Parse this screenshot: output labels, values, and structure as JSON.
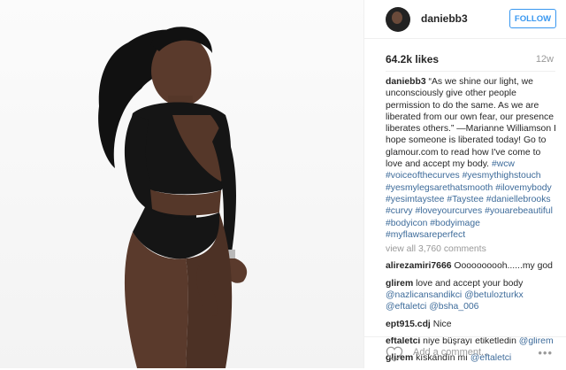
{
  "post": {
    "username": "daniebb3",
    "follow_label": "FOLLOW",
    "likes": "64.2k likes",
    "age": "12w",
    "caption": [
      {
        "t": "text",
        "v": "“As we shine our light, we unconsciously give other people permission to do the same. As we are liberated from our own fear, our presence liberates others.” —Marianne Williamson I hope someone is liberated today! Go to glamour.com to read how I've come to love and accept my body. "
      },
      {
        "t": "tag",
        "v": "#wcw"
      },
      {
        "t": "text",
        "v": " "
      },
      {
        "t": "tag",
        "v": "#voiceofthecurves"
      },
      {
        "t": "text",
        "v": " "
      },
      {
        "t": "tag",
        "v": "#yesmythighstouch"
      },
      {
        "t": "text",
        "v": " "
      },
      {
        "t": "tag",
        "v": "#yesmylegsarethatsmooth"
      },
      {
        "t": "text",
        "v": " "
      },
      {
        "t": "tag",
        "v": "#ilovemybody"
      },
      {
        "t": "text",
        "v": " "
      },
      {
        "t": "tag",
        "v": "#yesimtaystee"
      },
      {
        "t": "text",
        "v": " "
      },
      {
        "t": "tag",
        "v": "#Taystee"
      },
      {
        "t": "text",
        "v": " "
      },
      {
        "t": "tag",
        "v": "#daniellebrooks"
      },
      {
        "t": "text",
        "v": " "
      },
      {
        "t": "tag",
        "v": "#curvy"
      },
      {
        "t": "text",
        "v": " "
      },
      {
        "t": "tag",
        "v": "#loveyourcurves"
      },
      {
        "t": "text",
        "v": " "
      },
      {
        "t": "tag",
        "v": "#youarebeautiful"
      },
      {
        "t": "text",
        "v": " "
      },
      {
        "t": "tag",
        "v": "#bodyicon"
      },
      {
        "t": "text",
        "v": " "
      },
      {
        "t": "tag",
        "v": "#bodyimage"
      },
      {
        "t": "text",
        "v": " "
      },
      {
        "t": "tag",
        "v": "#myflawsareperfect"
      }
    ],
    "view_all": "view all 3,760 comments",
    "comments": [
      {
        "user": "alirezamiri7666",
        "parts": [
          {
            "t": "text",
            "v": "Oooooooooh......my god"
          }
        ]
      },
      {
        "user": "glirem",
        "parts": [
          {
            "t": "text",
            "v": "love and accept your body "
          },
          {
            "t": "tag",
            "v": "@nazlicansandikci"
          },
          {
            "t": "text",
            "v": " "
          },
          {
            "t": "tag",
            "v": "@betulozturkx"
          },
          {
            "t": "text",
            "v": " "
          },
          {
            "t": "tag",
            "v": "@eftaletci"
          },
          {
            "t": "text",
            "v": " "
          },
          {
            "t": "tag",
            "v": "@bsha_006"
          }
        ]
      },
      {
        "user": "ept915.cdj",
        "parts": [
          {
            "t": "text",
            "v": "Nice"
          }
        ]
      },
      {
        "user": "eftaletci",
        "parts": [
          {
            "t": "text",
            "v": "niye büşrayı etiketledin "
          },
          {
            "t": "tag",
            "v": "@glirem"
          }
        ]
      },
      {
        "user": "glirem",
        "parts": [
          {
            "t": "text",
            "v": "kıskandın mı "
          },
          {
            "t": "tag",
            "v": "@eftaletci"
          }
        ]
      }
    ],
    "add_comment_placeholder": "Add a comment...",
    "icons": {
      "like": "heart-icon",
      "more": "more-dots-icon"
    },
    "colors": {
      "link": "#3d6b9a",
      "follow": "#3897f0",
      "muted": "#999999"
    }
  }
}
